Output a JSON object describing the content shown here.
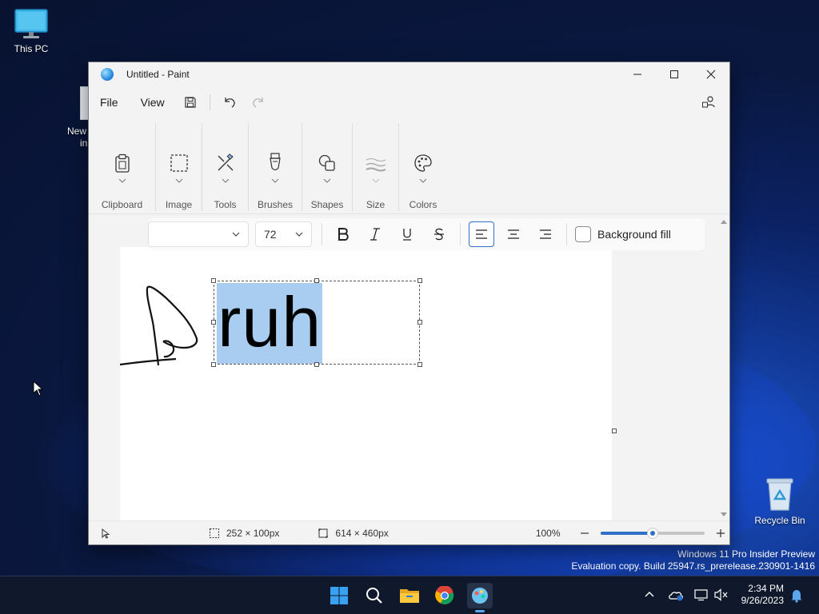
{
  "desktop": {
    "icons": [
      {
        "label": "This PC"
      },
      {
        "label": "Recycle Bin"
      }
    ],
    "partial_label_line1": "New",
    "partial_label_line2": "in",
    "watermark_line1": "Windows 11 Pro Insider Preview",
    "watermark_line2": "Evaluation copy. Build 25947.rs_prerelease.230901-1416"
  },
  "window": {
    "title": "Untitled - Paint",
    "menu": {
      "file": "File",
      "view": "View"
    },
    "ribbon_groups": [
      {
        "label": "Clipboard",
        "icon": "clipboard-icon"
      },
      {
        "label": "Image",
        "icon": "select-icon"
      },
      {
        "label": "Tools",
        "icon": "tools-icon"
      },
      {
        "label": "Brushes",
        "icon": "brush-icon"
      },
      {
        "label": "Shapes",
        "icon": "shapes-icon"
      },
      {
        "label": "Size",
        "icon": "size-icon"
      },
      {
        "label": "Colors",
        "icon": "palette-icon"
      }
    ],
    "text_toolbar": {
      "font_family": "",
      "font_size": "72",
      "background_fill_label": "Background fill",
      "background_fill_checked": false
    },
    "canvas": {
      "text": "ruh"
    },
    "status": {
      "selection_size": "252 × 100px",
      "canvas_size": "614 × 460px",
      "zoom": "100%",
      "zoom_slider_fraction": 0.5
    }
  },
  "taskbar": {
    "apps": [
      "start-icon",
      "search-icon",
      "file-explorer-icon",
      "chrome-icon",
      "paint-icon"
    ],
    "time": "2:34 PM",
    "date": "9/26/2023"
  },
  "colors": {
    "accent": "#2e6fc7",
    "selection_highlight": "#a8cdf0"
  }
}
